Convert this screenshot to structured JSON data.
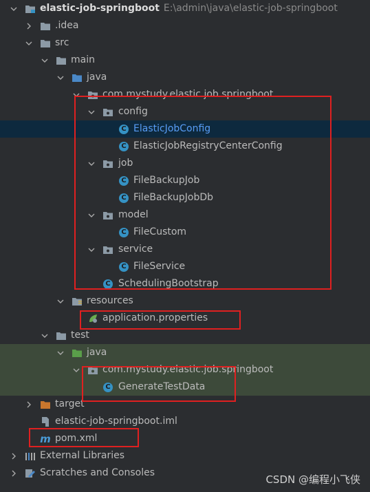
{
  "tree": {
    "root": {
      "label": "elastic-job-springboot",
      "path": "E:\\admin\\java\\elastic-job-springboot"
    },
    "idea": "idea",
    "src": "src",
    "main": "main",
    "java_main": "java",
    "package_main": "com.mystudy.elastic.job.springboot",
    "config": "config",
    "elastic_job_config": "ElasticJobConfig",
    "elastic_job_registry_center_config": "ElasticJobRegistryCenterConfig",
    "job": "job",
    "file_backup_job": "FileBackupJob",
    "file_backup_job_db": "FileBackupJobDb",
    "model": "model",
    "file_custom": "FileCustom",
    "service": "service",
    "file_service": "FileService",
    "scheduling_bootstrap": "SchedulingBootstrap",
    "resources": "resources",
    "application_properties": "application.properties",
    "test": "test",
    "java_test": "java",
    "package_test": "com.mystudy.elastic.job.springboot",
    "generate_test_data": "GenerateTestData",
    "target": "target",
    "iml_file": "elastic-job-springboot.iml",
    "pom": "pom.xml",
    "external_libraries": "External Libraries",
    "scratches": "Scratches and Consoles"
  },
  "watermark": "CSDN @编程小飞侠",
  "colors": {
    "background": "#2b2d30",
    "selected_row": "#0d293e",
    "test_row": "#3d4a3a",
    "link_text": "#589df6",
    "highlight_box": "#e02020",
    "class_icon": "#3592c4",
    "folder": "#8c9aa6",
    "test_folder": "#5a9e4a",
    "target_folder": "#c8762d"
  }
}
